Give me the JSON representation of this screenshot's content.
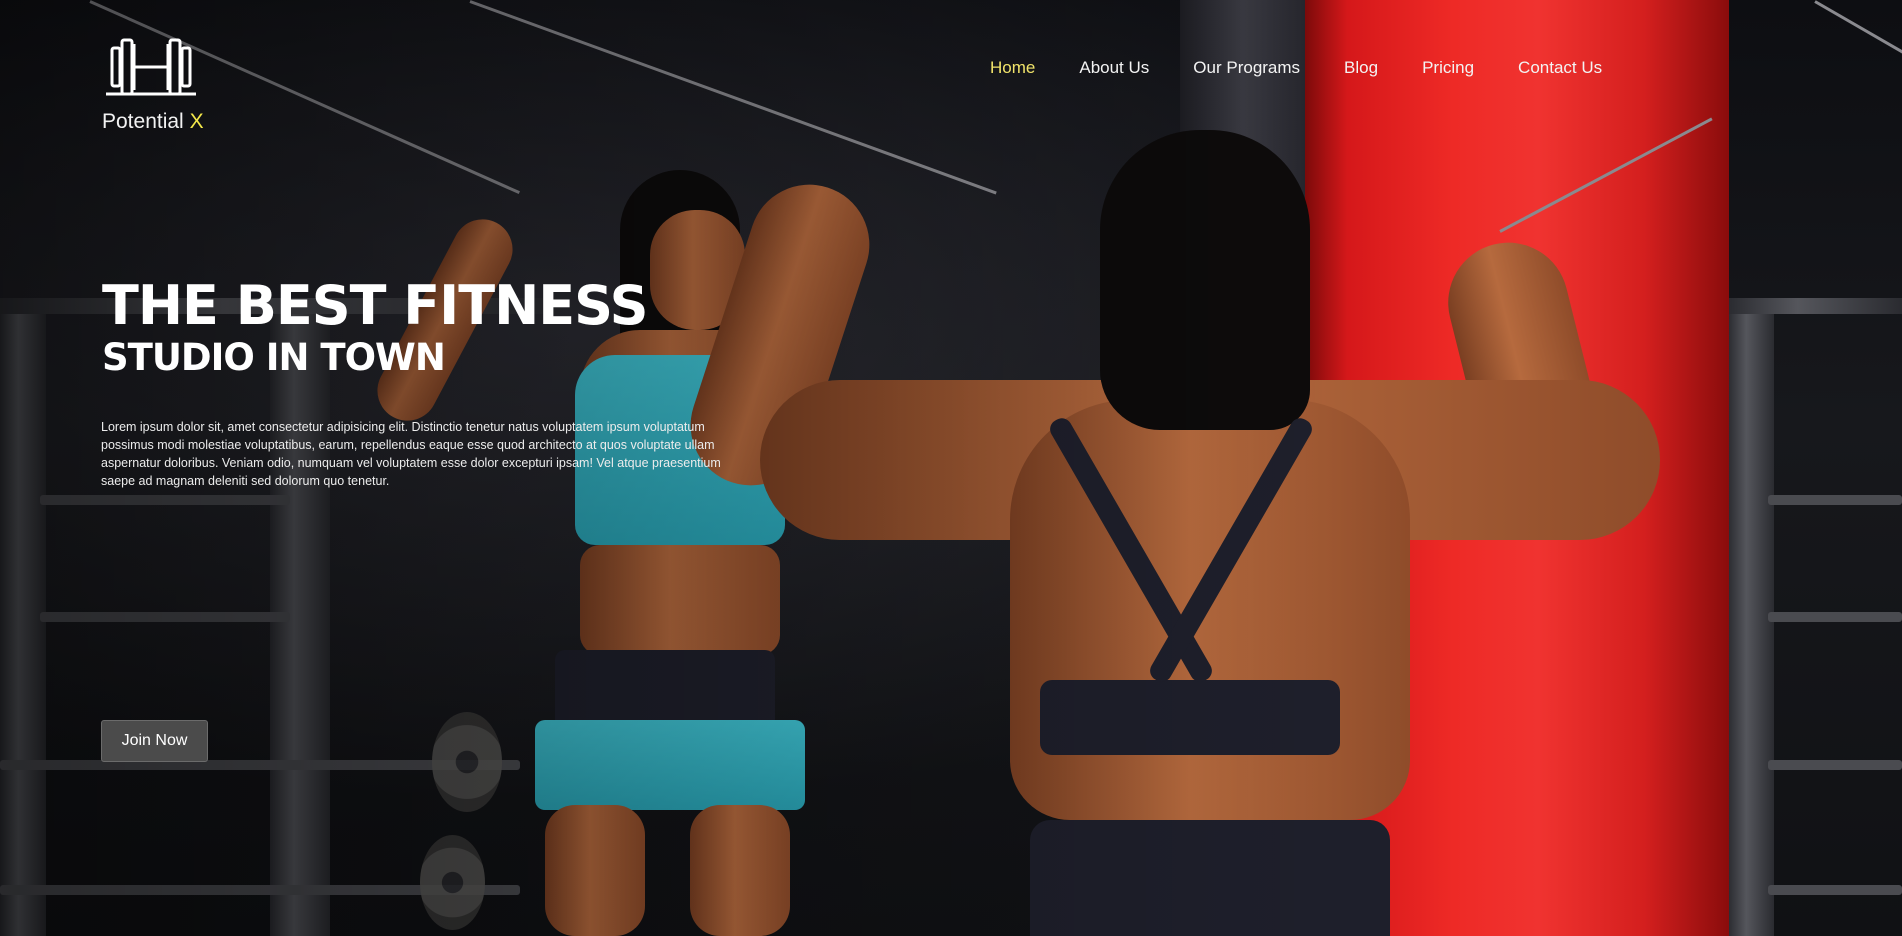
{
  "brand": {
    "name": "Potential",
    "accent": "X",
    "logo_icon": "barbell-H-icon",
    "accent_color": "#f3e84a"
  },
  "nav": {
    "items": [
      {
        "label": "Home",
        "active": true
      },
      {
        "label": "About Us",
        "active": false
      },
      {
        "label": "Our Programs",
        "active": false
      },
      {
        "label": "Blog",
        "active": false
      },
      {
        "label": "Pricing",
        "active": false
      },
      {
        "label": "Contact Us",
        "active": false
      }
    ],
    "active_color": "#f0e36a"
  },
  "hero": {
    "title_line1": "THE BEST FITNESS",
    "title_line2": "STUDIO IN TOWN",
    "description": "Lorem ipsum dolor sit, amet consectetur adipisicing elit. Distinctio tenetur natus voluptatem ipsum voluptatum possimus modi molestiae voluptatibus, earum, repellendus eaque esse quod architecto at quos voluptate ullam aspernatur doloribus. Veniam odio, numquam vel voluptatem esse dolor excepturi ipsam! Vel atque praesentium saepe ad magnam deleniti sed dolorum quo tenetur.",
    "cta_label": "Join Now"
  }
}
